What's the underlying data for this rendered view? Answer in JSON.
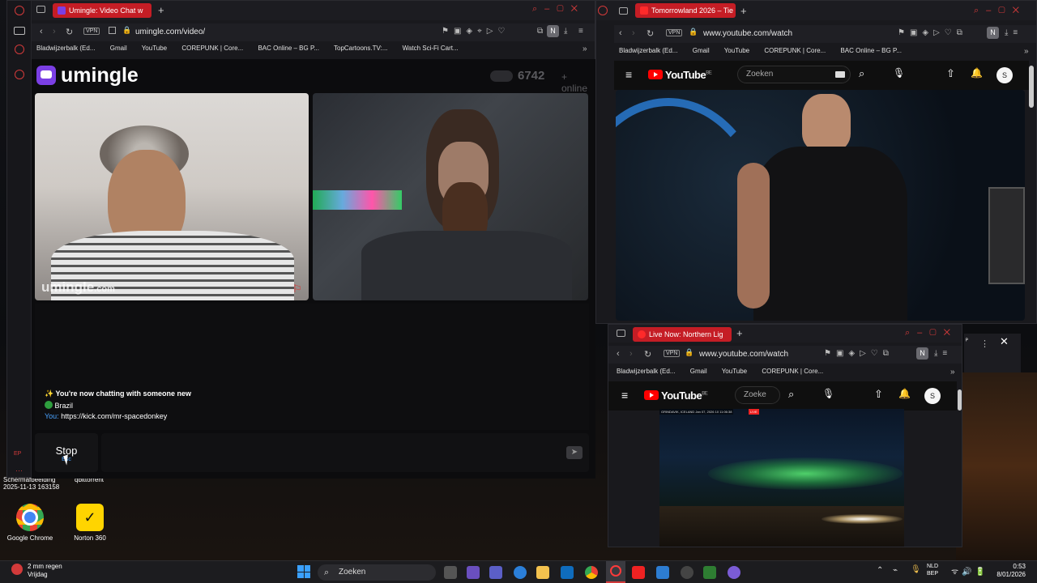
{
  "colors": {
    "opera_red": "#c51d25",
    "yt_red": "#ff0000",
    "umingle_purple": "#7b3fe4",
    "aurora": "#3fbf5a"
  },
  "umingle_window": {
    "tab_title": "Umingle: Video Chat w",
    "url": "umingle.com/video/",
    "vpn": "VPN",
    "bookmarks": [
      "Bladwijzerbalk (Ed...",
      "Gmail",
      "YouTube",
      "COREPUNK | Core...",
      "BAC Online – BG P...",
      "TopCartoons.TV:...",
      "Watch Sci-Fi Cart..."
    ],
    "brand": "umingle",
    "online_count": "6742",
    "online_label": "online",
    "watermark": "umingle",
    "watermark_suffix": ".com",
    "chat": {
      "new_chat": "You're now chatting with someone new",
      "country": "Brazil",
      "you_label": "You:",
      "you_message": "https://kick.com/mr-spacedonkey"
    },
    "stop_label": "Stop",
    "stop_sub": "Esc"
  },
  "yt_window_top": {
    "tab_title": "Tomorrowland 2026 – Tie",
    "url": "www.youtube.com/watch",
    "vpn": "VPN",
    "bookmarks": [
      "Bladwijzerbalk (Ed...",
      "Gmail",
      "YouTube",
      "COREPUNK | Core...",
      "BAC Online – BG P..."
    ],
    "yt_logo": "YouTube",
    "yt_region": "BE",
    "search_placeholder": "Zoeken",
    "avatar": "S"
  },
  "yt_window_bottom": {
    "tab_title": "Live Now: Northern Lig",
    "url": "www.youtube.com/watch",
    "vpn": "VPN",
    "bookmarks": [
      "Bladwijzerbalk (Ed...",
      "Gmail",
      "YouTube",
      "COREPUNK | Core..."
    ],
    "yt_logo": "YouTube",
    "yt_region": "BE",
    "search_placeholder": "Zoeke",
    "avatar": "S",
    "overlay_text": "GRINDAVIK, ICELAND  Jan 07, 2026 10 11:06:38",
    "live_badge": "LIVE"
  },
  "desktop": {
    "file_label_1": "Schermafbeelding",
    "file_label_2": "2025-11-13 163158",
    "file_label_3": "qbittorrent",
    "icons": [
      {
        "name": "Google Chrome"
      },
      {
        "name": "Norton 360"
      }
    ]
  },
  "taskbar": {
    "weather_temp": "2 mm regen",
    "weather_day": "Vrijdag",
    "search": "Zoeken",
    "lang_1": "NLD",
    "lang_2": "BEP",
    "time": "0:53",
    "date": "8/01/2026"
  },
  "misc": {
    "ep_label": "EP"
  }
}
